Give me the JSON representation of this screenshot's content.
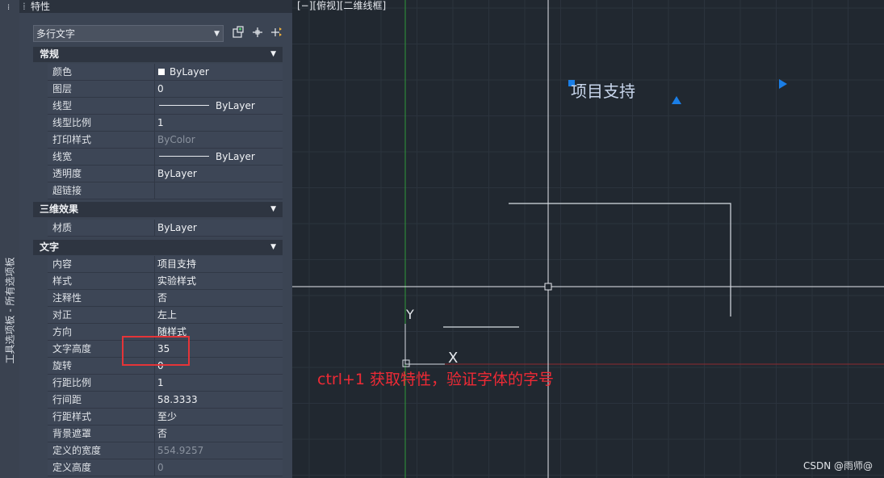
{
  "side_tab": {
    "label": "工具选项板 - 所有选项板"
  },
  "panel": {
    "title": "特性",
    "selector": "多行文字",
    "tool_icons": [
      "select-objects-icon",
      "quick-select-icon",
      "toggle-pickadd-icon"
    ],
    "sections": [
      {
        "name": "常规",
        "rows": [
          {
            "key": "颜色",
            "value": "ByLayer",
            "swatch": true
          },
          {
            "key": "图层",
            "value": "0"
          },
          {
            "key": "线型",
            "value": "ByLayer",
            "linetype": true
          },
          {
            "key": "线型比例",
            "value": "1"
          },
          {
            "key": "打印样式",
            "value": "ByColor",
            "dim": true
          },
          {
            "key": "线宽",
            "value": "ByLayer",
            "linetype": true
          },
          {
            "key": "透明度",
            "value": "ByLayer"
          },
          {
            "key": "超链接",
            "value": ""
          }
        ]
      },
      {
        "name": "三维效果",
        "rows": [
          {
            "key": "材质",
            "value": "ByLayer"
          }
        ]
      },
      {
        "name": "文字",
        "rows": [
          {
            "key": "内容",
            "value": "项目支持"
          },
          {
            "key": "样式",
            "value": "实验样式"
          },
          {
            "key": "注释性",
            "value": "否"
          },
          {
            "key": "对正",
            "value": "左上"
          },
          {
            "key": "方向",
            "value": "随样式"
          },
          {
            "key": "文字高度",
            "value": "35"
          },
          {
            "key": "旋转",
            "value": "0"
          },
          {
            "key": "行距比例",
            "value": "1"
          },
          {
            "key": "行间距",
            "value": "58.3333"
          },
          {
            "key": "行距样式",
            "value": "至少"
          },
          {
            "key": "背景遮罩",
            "value": "否"
          },
          {
            "key": "定义的宽度",
            "value": "554.9257",
            "dim": true
          },
          {
            "key": "定义高度",
            "value": "0",
            "dim": true
          }
        ]
      }
    ]
  },
  "viewport": {
    "label": "[−][俯视][二维线框]",
    "mtext": "项目支持",
    "ucs_x": "X",
    "ucs_y": "Y"
  },
  "annotation": "ctrl+1 获取特性，验证字体的字号",
  "watermark": "CSDN @雨师@",
  "colors": {
    "canvas_bg": "#212830",
    "grid": "#2b333d",
    "grip": "#1a7ee6",
    "annotation": "#ee2a35"
  }
}
